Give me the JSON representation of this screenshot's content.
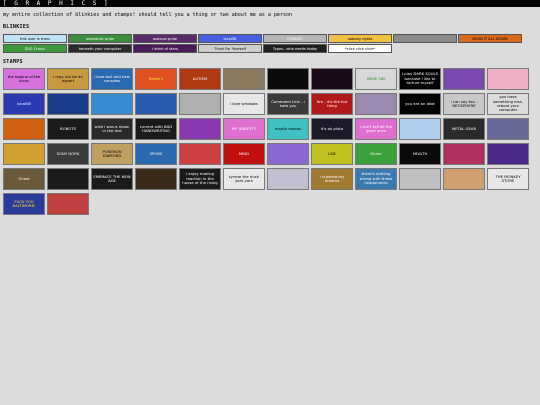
{
  "header": {
    "title": "[ G R A P H I C S ]"
  },
  "intro": "my entire collection of blinkies and stamps! should tell you a thing or two about me as a person",
  "sections": {
    "blinkies": "BLINKIES",
    "stamps": "STAMPS"
  },
  "blinkies": [
    {
      "label": "this user is trans",
      "bg": "#bfe3f7",
      "fg": "#000000"
    },
    {
      "label": "aromantic pride",
      "bg": "#3c8d3c",
      "fg": "#ffffff"
    },
    {
      "label": "asexual pride",
      "bg": "#5a2a6b",
      "fg": "#ffffff"
    },
    {
      "label": "local58",
      "bg": "#4460e0",
      "fg": "#ffffff"
    },
    {
      "label": "STARSET",
      "bg": "#b5b5b5",
      "fg": "#ffffff"
    },
    {
      "label": "nobody rights",
      "bg": "#f0c040",
      "fg": "#000000"
    },
    {
      "label": "",
      "bg": "#8a8a8a",
      "fg": "#000000"
    },
    {
      "label": "BURN IT ALL DOWN",
      "bg": "#d96a1a",
      "fg": "#000000"
    },
    {
      "label": "DVD Crazy!",
      "bg": "#3a9a3a",
      "fg": "#ffffff"
    },
    {
      "label": "beneath your computer",
      "bg": "#2a2a2a",
      "fg": "#ffffff"
    },
    {
      "label": "i drink of stars",
      "bg": "#4a1a5a",
      "fg": "#ffffff"
    },
    {
      "label": "Think For Yourself",
      "bg": "#cfcfcf",
      "fg": "#000000"
    },
    {
      "label": "Typos...who needs today",
      "bg": "#202020",
      "fg": "#ffffff"
    },
    {
      "label": "*click click click*",
      "bg": "#ffffff",
      "fg": "#000000"
    }
  ],
  "stamps": [
    {
      "label": "the legend of the pizza",
      "bg": "#d870e0",
      "fg": "#000000"
    },
    {
      "label": "i may not be an expert",
      "bg": "#c89a40",
      "fg": "#000000"
    },
    {
      "label": "i love bull and new consoles",
      "bg": "#2a6ab0",
      "fg": "#ffffff"
    },
    {
      "label": "Reese's",
      "bg": "#e05020",
      "fg": "#ffe040"
    },
    {
      "label": "AUTISM",
      "bg": "#b03a10",
      "fg": "#ffffff"
    },
    {
      "label": "",
      "bg": "#8a7a60",
      "fg": "#000000"
    },
    {
      "label": "",
      "bg": "#0a0a0a",
      "fg": "#ffffff"
    },
    {
      "label": "",
      "bg": "#1a0a1a",
      "fg": "#ffffff"
    },
    {
      "label": "XBOX 360",
      "bg": "#d8d8d8",
      "fg": "#2a8a2a"
    },
    {
      "label": "I play DARK SOULS because i like to torture myself",
      "bg": "#000000",
      "fg": "#ffffff"
    },
    {
      "label": "",
      "bg": "#7a4ab0",
      "fg": "#ffffff"
    },
    {
      "label": "",
      "bg": "#f0b0c8",
      "fg": "#000000"
    },
    {
      "label": "local58",
      "bg": "#2a3ab0",
      "fg": "#ffffff"
    },
    {
      "label": "",
      "bg": "#1a3a8a",
      "fg": "#ffffff"
    },
    {
      "label": "",
      "bg": "#3a8ad0",
      "fg": "#ffffff"
    },
    {
      "label": "",
      "bg": "#2a5ab0",
      "fg": "#ffffff"
    },
    {
      "label": "",
      "bg": "#b0b0b0",
      "fg": "#000000"
    },
    {
      "label": "i love windows",
      "bg": "#e8e8e8",
      "fg": "#000000"
    },
    {
      "label": "Command Line - i hate you",
      "bg": "#3a3a3a",
      "fg": "#ffffff"
    },
    {
      "label": "fire - it's the hot thing",
      "bg": "#b01a1a",
      "fg": "#ffffff"
    },
    {
      "label": "",
      "bg": "#9a8ab0",
      "fg": "#000000"
    },
    {
      "label": "you are an idiot",
      "bg": "#000000",
      "fg": "#ffffff"
    },
    {
      "label": "i can say too - NEOSPHERE",
      "bg": "#c8c8c8",
      "fg": "#000000"
    },
    {
      "label": "you have something else, reboot your computer",
      "bg": "#dcdcdc",
      "fg": "#000000"
    },
    {
      "label": "",
      "bg": "#d06010",
      "fg": "#ffffff"
    },
    {
      "label": "ROBOTS",
      "bg": "#1a1a1a",
      "fg": "#ffffff"
    },
    {
      "label": "wish i was a moon in the dvd",
      "bg": "#2a2a2a",
      "fg": "#ffffff"
    },
    {
      "label": "current with BAD HANDWRITING",
      "bg": "#1a1a1a",
      "fg": "#ffffff"
    },
    {
      "label": "",
      "bg": "#8a3ab0",
      "fg": "#ffffff"
    },
    {
      "label": "MY IDENTITY",
      "bg": "#e070d0",
      "fg": "#ffffff"
    },
    {
      "label": "mouth moods",
      "bg": "#40c0c0",
      "fg": "#000000"
    },
    {
      "label": "it's ok pluto",
      "bg": "#1a1a2a",
      "fg": "#ffffff"
    },
    {
      "label": "i can't tell all the good ones",
      "bg": "#e070d0",
      "fg": "#ffffff"
    },
    {
      "label": "",
      "bg": "#b0d0f0",
      "fg": "#000000"
    },
    {
      "label": "METAL GEAR",
      "bg": "#2a2a2a",
      "fg": "#ffffff"
    },
    {
      "label": "",
      "bg": "#6a6a9a",
      "fg": "#ffffff"
    },
    {
      "label": "",
      "bg": "#d0a030",
      "fg": "#000000"
    },
    {
      "label": "SONY DORK",
      "bg": "#3a3a3a",
      "fg": "#ffffff"
    },
    {
      "label": "POKEMON DIAMOND",
      "bg": "#c0a060",
      "fg": "#000000"
    },
    {
      "label": "SPORE",
      "bg": "#2a6ab0",
      "fg": "#ffffff"
    },
    {
      "label": "",
      "bg": "#d04040",
      "fg": "#ffffff"
    },
    {
      "label": "MIND",
      "bg": "#c01010",
      "fg": "#ffffff"
    },
    {
      "label": "",
      "bg": "#8a6ad0",
      "fg": "#ffffff"
    },
    {
      "label": "LSD",
      "bg": "#c0c020",
      "fg": "#000000"
    },
    {
      "label": "Mcine",
      "bg": "#3aa03a",
      "fg": "#ffffff"
    },
    {
      "label": "HEALTH",
      "bg": "#0a0a0a",
      "fg": "#ffffff"
    },
    {
      "label": "",
      "bg": "#b03060",
      "fg": "#ffffff"
    },
    {
      "label": "",
      "bg": "#4a2a8a",
      "fg": "#ffffff"
    },
    {
      "label": "Ghost",
      "bg": "#6a5a3a",
      "fg": "#ffffff"
    },
    {
      "label": "",
      "bg": "#1a1a1a",
      "fg": "#ffffff"
    },
    {
      "label": "EMBRACE THE NEW AGE",
      "bg": "#1a1a1a",
      "fg": "#ffffff"
    },
    {
      "label": "",
      "bg": "#3a2a1a",
      "fg": "#ffffff"
    },
    {
      "label": "i enjoy making reaction in the house of the rising",
      "bg": "#1a1a1a",
      "fg": "#ffffff"
    },
    {
      "label": "tyrone the duck york york",
      "bg": "#e8e8e8",
      "fg": "#000000"
    },
    {
      "label": "",
      "bg": "#c0c0d0",
      "fg": "#000000"
    },
    {
      "label": "i crashed my dreams",
      "bg": "#a07a30",
      "fg": "#ffffff"
    },
    {
      "label": "there's nothing wrong with these headphones",
      "bg": "#3a7ab0",
      "fg": "#ffffff"
    },
    {
      "label": "",
      "bg": "#c0c0c0",
      "fg": "#000000"
    },
    {
      "label": "",
      "bg": "#d0a070",
      "fg": "#000000"
    },
    {
      "label": "THE MONKEY STORE",
      "bg": "#e8e8e8",
      "fg": "#000000"
    },
    {
      "label": "FUCK YOU BALTIMORE!",
      "bg": "#2a3a9a",
      "fg": "#ffe040"
    },
    {
      "label": "",
      "bg": "#c04040",
      "fg": "#ffffff"
    }
  ]
}
